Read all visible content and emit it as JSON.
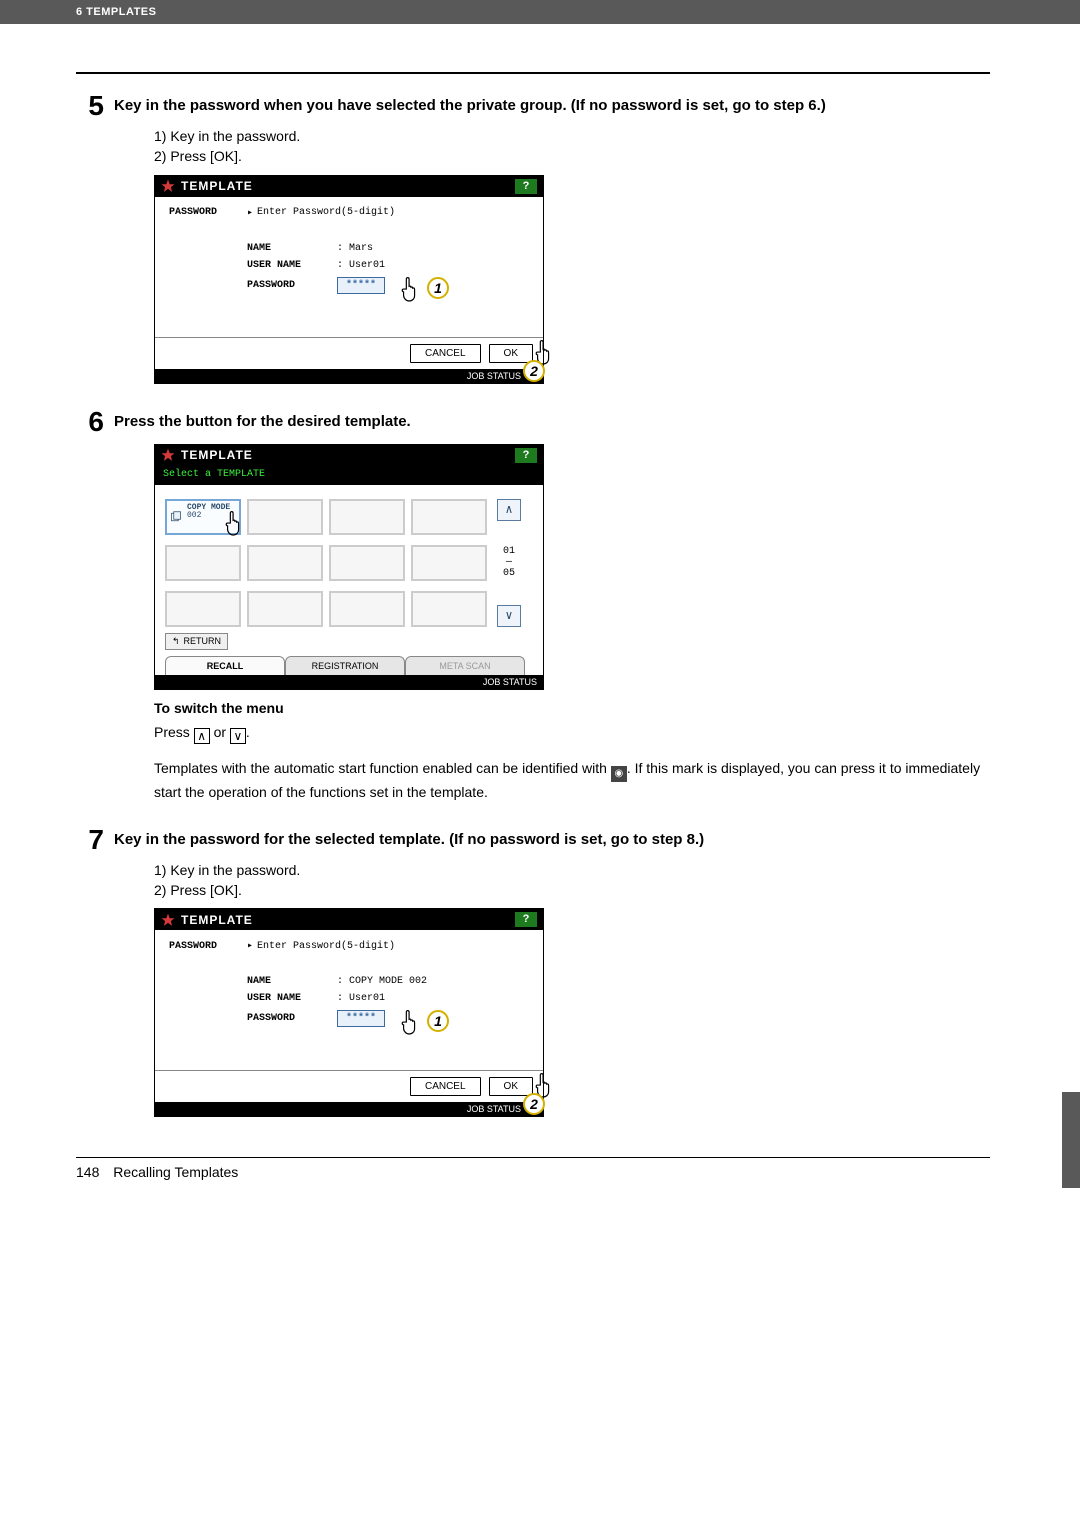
{
  "header": {
    "section": "6 TEMPLATES"
  },
  "step5": {
    "number": "5",
    "title": "Key in the password when you have selected the private group. (If no password is set, go to step 6.)",
    "sub1": "1)  Key in the password.",
    "sub2": "2)  Press [OK]."
  },
  "panel1": {
    "title": "TEMPLATE",
    "help": "?",
    "side_label": "PASSWORD",
    "prompt": "Enter Password(5-digit)",
    "name_label": "NAME",
    "name_value": ": Mars",
    "user_label": "USER NAME",
    "user_value": ": User01",
    "pw_label": "PASSWORD",
    "pw_value": "*****",
    "cancel": "CANCEL",
    "ok": "OK",
    "status": "JOB STATUS",
    "bubble1": "1",
    "bubble2": "2"
  },
  "step6": {
    "number": "6",
    "title": "Press the button for the desired template."
  },
  "panel2": {
    "title": "TEMPLATE",
    "help": "?",
    "subtitle": "Select a TEMPLATE",
    "slot_ln1": "COPY MODE",
    "slot_ln2": "002",
    "page_top": "01",
    "page_bot": "05",
    "return": "RETURN",
    "tab_recall": "RECALL",
    "tab_reg": "REGISTRATION",
    "tab_meta": "META SCAN",
    "status": "JOB STATUS"
  },
  "switch": {
    "head": "To switch the menu",
    "press": "Press ",
    "or": " or ",
    "period": "."
  },
  "note6": {
    "t1": "Templates with the automatic start function enabled can be identified with ",
    "t2": ". If this mark is displayed, you can press it to immediately start the operation of the functions set in the template."
  },
  "step7": {
    "number": "7",
    "title": "Key in the password for the selected template. (If no password is set, go to step 8.)",
    "sub1": "1)  Key in the password.",
    "sub2": "2)  Press [OK]."
  },
  "panel3": {
    "title": "TEMPLATE",
    "help": "?",
    "side_label": "PASSWORD",
    "prompt": "Enter Password(5-digit)",
    "name_label": "NAME",
    "name_value": ": COPY MODE 002",
    "user_label": "USER NAME",
    "user_value": ": User01",
    "pw_label": "PASSWORD",
    "pw_value": "*****",
    "cancel": "CANCEL",
    "ok": "OK",
    "status": "JOB STATUS",
    "bubble1": "1",
    "bubble2": "2"
  },
  "footer": {
    "page": "148",
    "title": "Recalling Templates"
  },
  "icons": {
    "up": "∧",
    "down": "∨",
    "mark": "◉",
    "arrow": "▸",
    "return_arrow": "↰"
  }
}
